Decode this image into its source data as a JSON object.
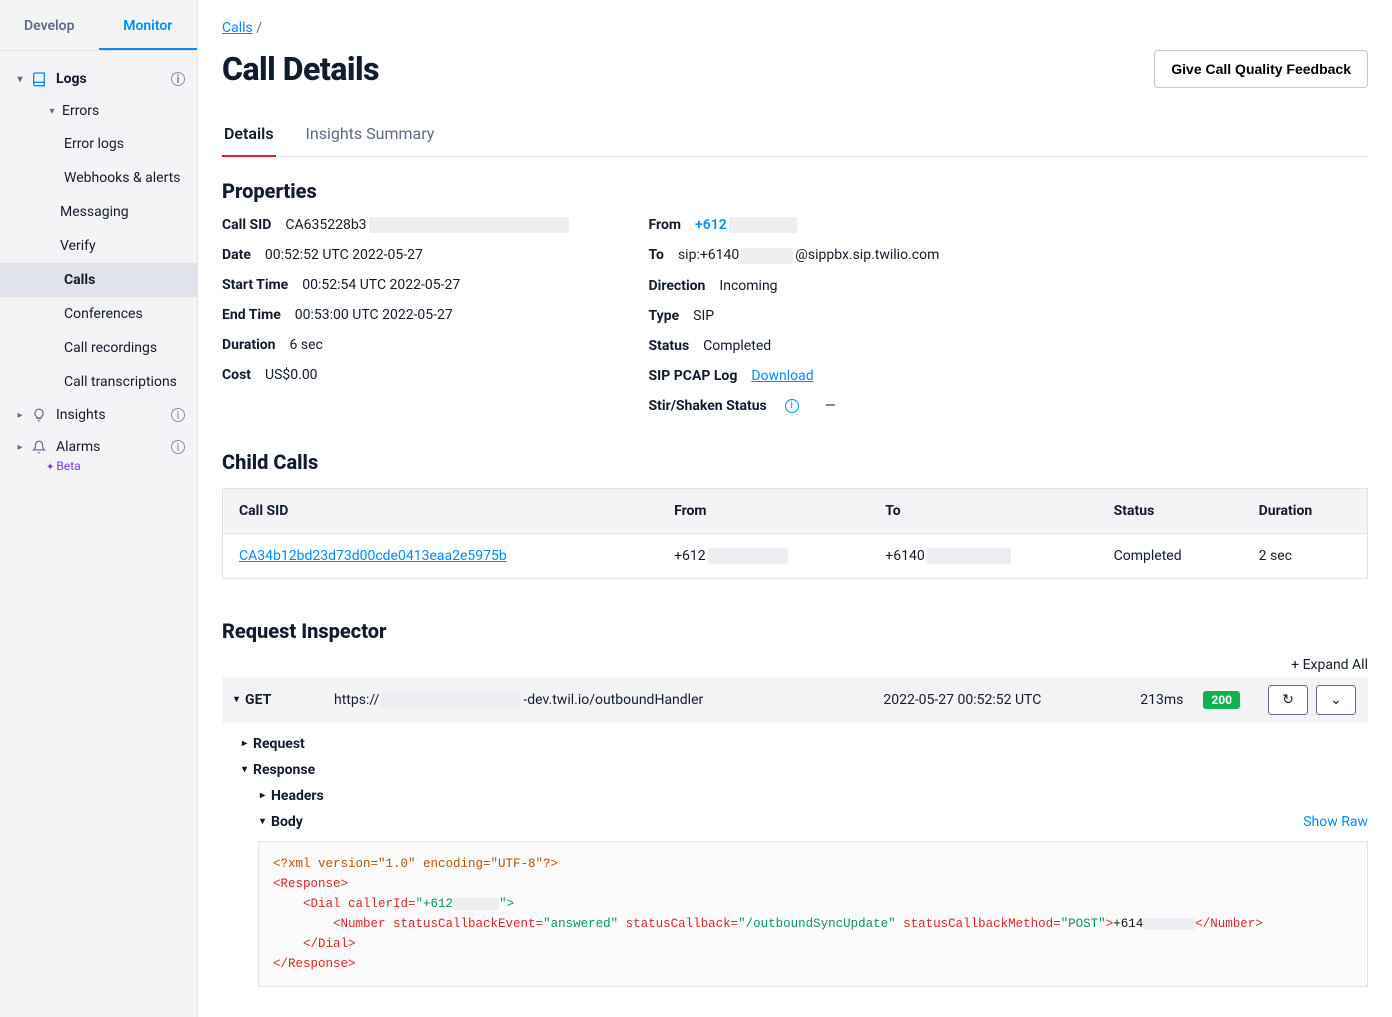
{
  "top_tabs": {
    "develop": "Develop",
    "monitor": "Monitor"
  },
  "sidebar": {
    "logs": "Logs",
    "errors": "Errors",
    "error_logs": "Error logs",
    "webhooks": "Webhooks & alerts",
    "messaging": "Messaging",
    "verify": "Verify",
    "calls": "Calls",
    "conferences": "Conferences",
    "recordings": "Call recordings",
    "transcriptions": "Call transcriptions",
    "insights": "Insights",
    "alarms": "Alarms",
    "beta": "Beta"
  },
  "breadcrumb": {
    "calls": "Calls",
    "sep": " / "
  },
  "page_title": "Call Details",
  "feedback_btn": "Give Call Quality Feedback",
  "detail_tabs": {
    "details": "Details",
    "insights": "Insights Summary"
  },
  "sections": {
    "properties": "Properties",
    "child_calls": "Child Calls",
    "inspector": "Request Inspector"
  },
  "props": {
    "call_sid_label": "Call SID",
    "call_sid": "CA635228b3",
    "date_label": "Date",
    "date": "00:52:52 UTC 2022-05-27",
    "start_label": "Start Time",
    "start": "00:52:54 UTC 2022-05-27",
    "end_label": "End Time",
    "end": "00:53:00 UTC 2022-05-27",
    "duration_label": "Duration",
    "duration": "6 sec",
    "cost_label": "Cost",
    "cost": "US$0.00",
    "from_label": "From",
    "from": "+612",
    "to_label": "To",
    "to_prefix": "sip:+6140",
    "to_suffix": "@sippbx.sip.twilio.com",
    "direction_label": "Direction",
    "direction": "Incoming",
    "type_label": "Type",
    "type": "SIP",
    "status_label": "Status",
    "status": "Completed",
    "pcap_label": "SIP PCAP Log",
    "pcap_link": "Download",
    "stir_label": "Stir/Shaken Status",
    "stir_val": "—"
  },
  "child_table": {
    "headers": {
      "sid": "Call SID",
      "from": "From",
      "to": "To",
      "status": "Status",
      "duration": "Duration"
    },
    "row": {
      "sid": "CA34b12bd23d73d00cde0413eaa2e5975b",
      "from": "+612",
      "to": "+6140",
      "status": "Completed",
      "duration": "2 sec"
    }
  },
  "inspector": {
    "expand_all": "+ Expand All",
    "method": "GET",
    "url_prefix": "https://",
    "url_suffix": "-dev.twil.io/outboundHandler",
    "timestamp": "2022-05-27 00:52:52 UTC",
    "duration": "213ms",
    "status_code": "200",
    "request": "Request",
    "response": "Response",
    "headers": "Headers",
    "body": "Body",
    "show_raw": "Show Raw"
  },
  "xml": {
    "decl": "<?xml version=\"1.0\" encoding=\"UTF-8\"?>",
    "resp_open": "<Response>",
    "dial_open_pre": "<Dial callerId=",
    "dial_callerid": "\"+612",
    "dial_open_post": "\">",
    "number_pre": "<Number statusCallbackEvent=",
    "number_evt": "\"answered\"",
    "number_cb_lbl": " statusCallback=",
    "number_cb": "\"/outboundSyncUpdate\"",
    "number_method_lbl": " statusCallbackMethod=",
    "number_method": "\"POST\"",
    "number_close": ">",
    "number_text": "+614",
    "number_end": "</Number>",
    "dial_close": "</Dial>",
    "resp_close": "</Response>"
  }
}
